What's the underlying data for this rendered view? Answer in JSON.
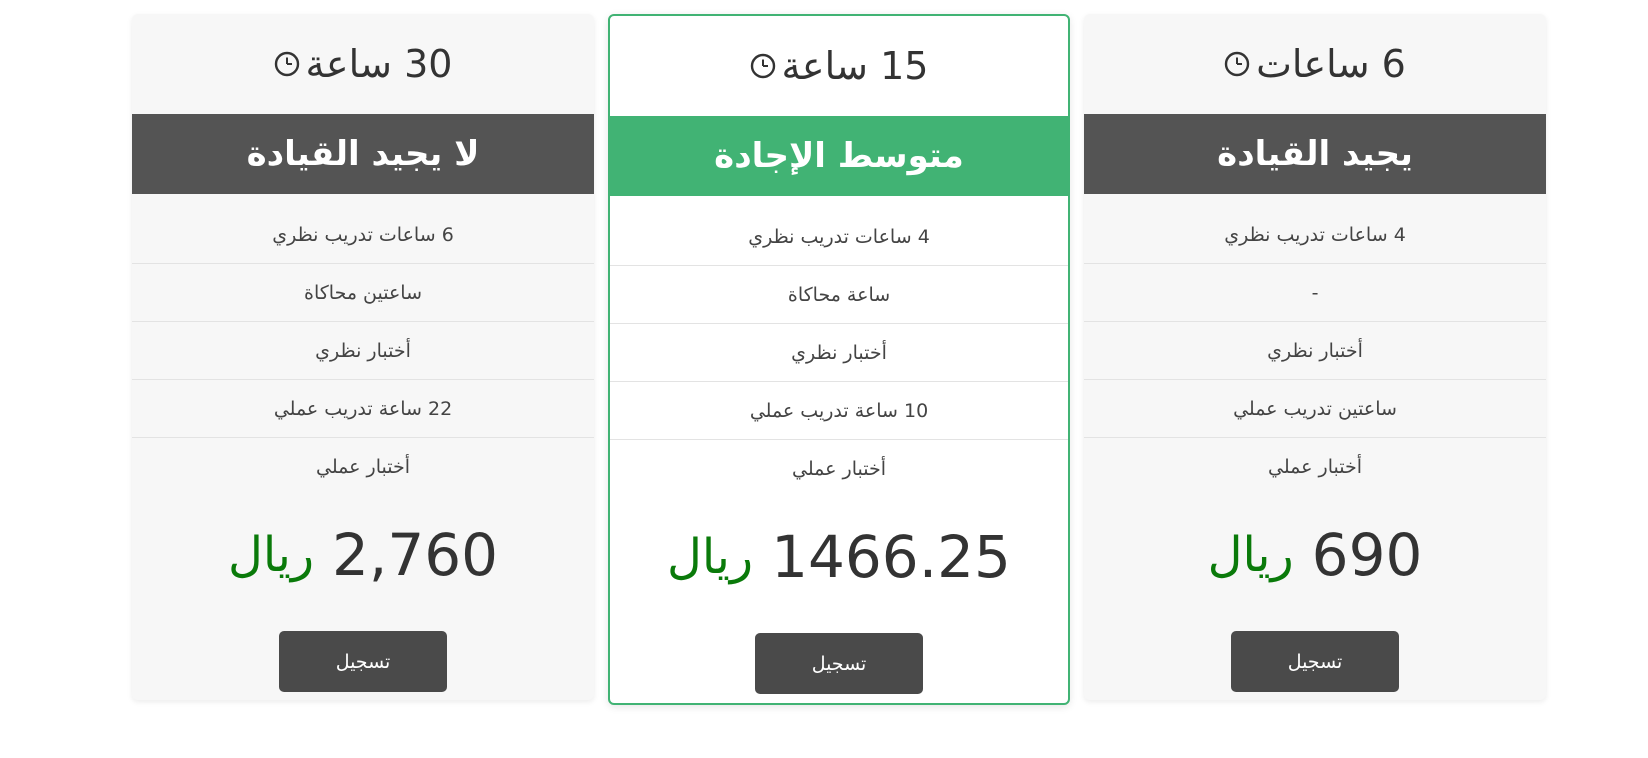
{
  "plans": [
    {
      "hours": "30 ساعة",
      "title": "لا يجيد القيادة",
      "features": [
        "6 ساعات تدريب نظري",
        "ساعتين محاكاة",
        "أختبار نظري",
        "22 ساعة تدريب عملي",
        "أختبار عملي"
      ],
      "price": "2,760",
      "currency": "ريال",
      "button_label": "تسجيل"
    },
    {
      "hours": "15 ساعة",
      "title": "متوسط الإجادة",
      "features": [
        "4 ساعات تدريب نظري",
        "ساعة محاكاة",
        "أختبار نظري",
        "10 ساعة تدريب عملي",
        "أختبار عملي"
      ],
      "price": "1466.25",
      "currency": "ريال",
      "button_label": "تسجيل"
    },
    {
      "hours": "6 ساعات",
      "title": "يجيد القيادة",
      "features": [
        "4 ساعات تدريب نظري",
        "-",
        "أختبار نظري",
        "ساعتين تدريب عملي",
        "أختبار عملي"
      ],
      "price": "690",
      "currency": "ريال",
      "button_label": "تسجيل"
    }
  ],
  "colors": {
    "accent": "#41b374",
    "dark_header": "#545454",
    "currency": "#0a7a0a",
    "button": "#4a4a4a"
  },
  "icons": {
    "hours": "clock-icon"
  }
}
